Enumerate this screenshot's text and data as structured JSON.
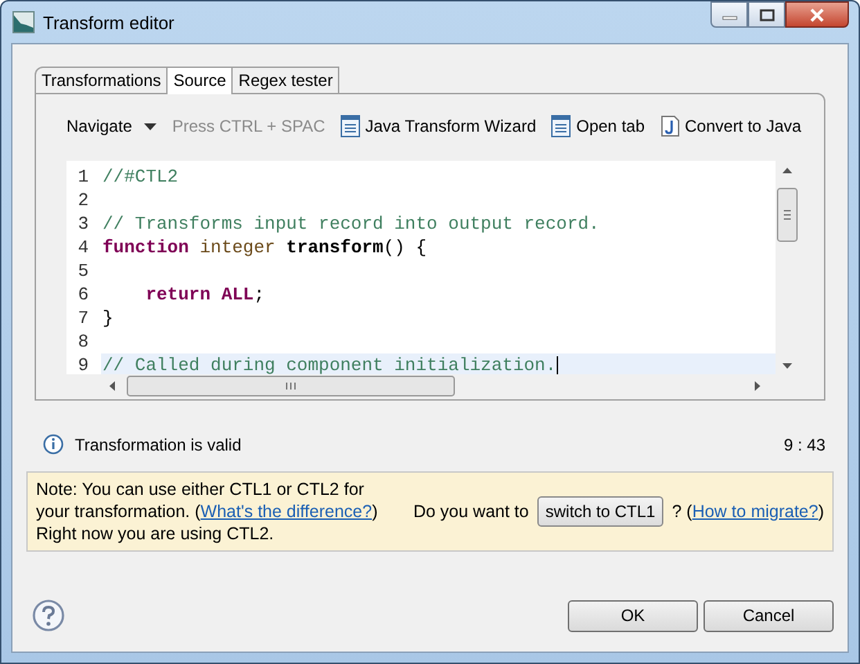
{
  "window": {
    "title": "Transform editor"
  },
  "tabs": [
    {
      "label": "Transformations",
      "selected": false
    },
    {
      "label": "Source",
      "selected": true
    },
    {
      "label": "Regex tester",
      "selected": false
    }
  ],
  "toolbar": {
    "navigate": "Navigate",
    "hint": "Press CTRL + SPAC",
    "actions": [
      {
        "label": "Java Transform Wizard",
        "kind": "document"
      },
      {
        "label": "Open tab",
        "kind": "document"
      },
      {
        "label": "Convert to Java",
        "kind": "java"
      }
    ]
  },
  "editor": {
    "lines": [
      {
        "number": "1",
        "current": false,
        "tokens": [
          {
            "kind": "comment",
            "text": "//#CTL2"
          }
        ]
      },
      {
        "number": "2",
        "current": false
      },
      {
        "number": "3",
        "current": false,
        "tokens": [
          {
            "kind": "comment",
            "text": "// Transforms input record into output record."
          }
        ]
      },
      {
        "number": "4",
        "current": false,
        "tokens": [
          {
            "kind": "keyword",
            "text": "function"
          },
          {
            "kind": "type",
            "text": " integer "
          },
          {
            "kind": "name",
            "text": "transform"
          },
          {
            "kind": "plain",
            "text": "() {"
          }
        ]
      },
      {
        "number": "5",
        "current": false
      },
      {
        "number": "6",
        "current": false,
        "tokens": [
          {
            "kind": "keyword",
            "text": "    return ALL"
          },
          {
            "kind": "plain",
            "text": ";"
          }
        ]
      },
      {
        "number": "7",
        "current": false,
        "tokens": [
          {
            "kind": "plain",
            "text": "}"
          }
        ]
      },
      {
        "number": "8",
        "current": false
      },
      {
        "number": "9",
        "current": true,
        "tokens": [
          {
            "kind": "comment",
            "text": "// Called during component initialization."
          }
        ]
      }
    ]
  },
  "status": {
    "message": "Transformation is valid",
    "position": "9 : 43"
  },
  "note": {
    "text_before": "Note: You can use either CTL1 or CTL2 for your transformation. (",
    "link": "What's the difference?",
    "text_after": ") Right now you are using CTL2.",
    "question": "Do you want to",
    "switch_button": "switch to CTL1",
    "question_mark": "? (",
    "migrate_link": "How to migrate?",
    "closing": ")"
  },
  "buttons": [
    "OK",
    "Cancel"
  ]
}
